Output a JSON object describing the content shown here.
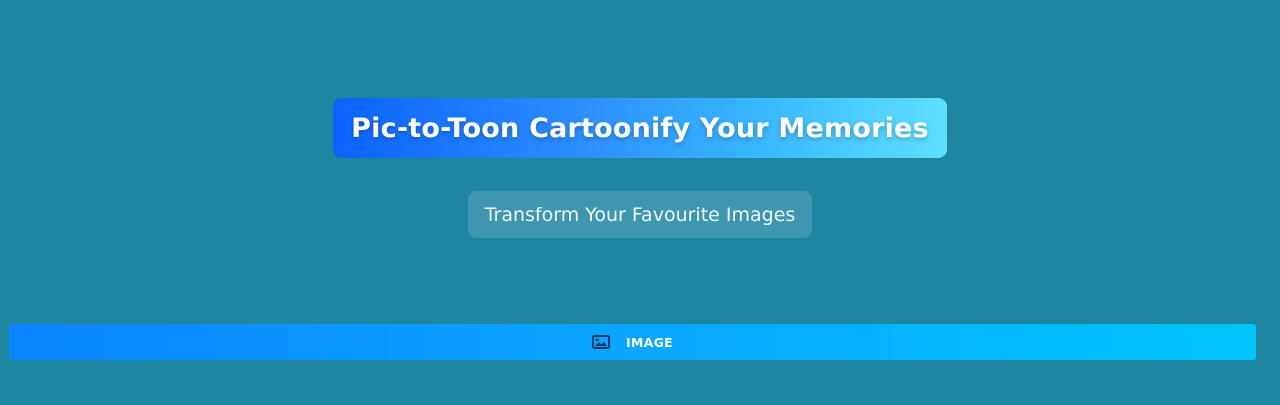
{
  "header": {
    "title": "Pic-to-Toon Cartoonify Your Memories",
    "subtitle": "Transform Your Favourite Images"
  },
  "upload": {
    "button_label": "IMAGE",
    "icon": "image-icon"
  },
  "colors": {
    "background": "#1f86a2",
    "title_gradient_start": "#0a63ff",
    "title_gradient_end": "#5fe0ff",
    "button_gradient_start": "#0a84ff",
    "button_gradient_end": "#00c6ff"
  }
}
